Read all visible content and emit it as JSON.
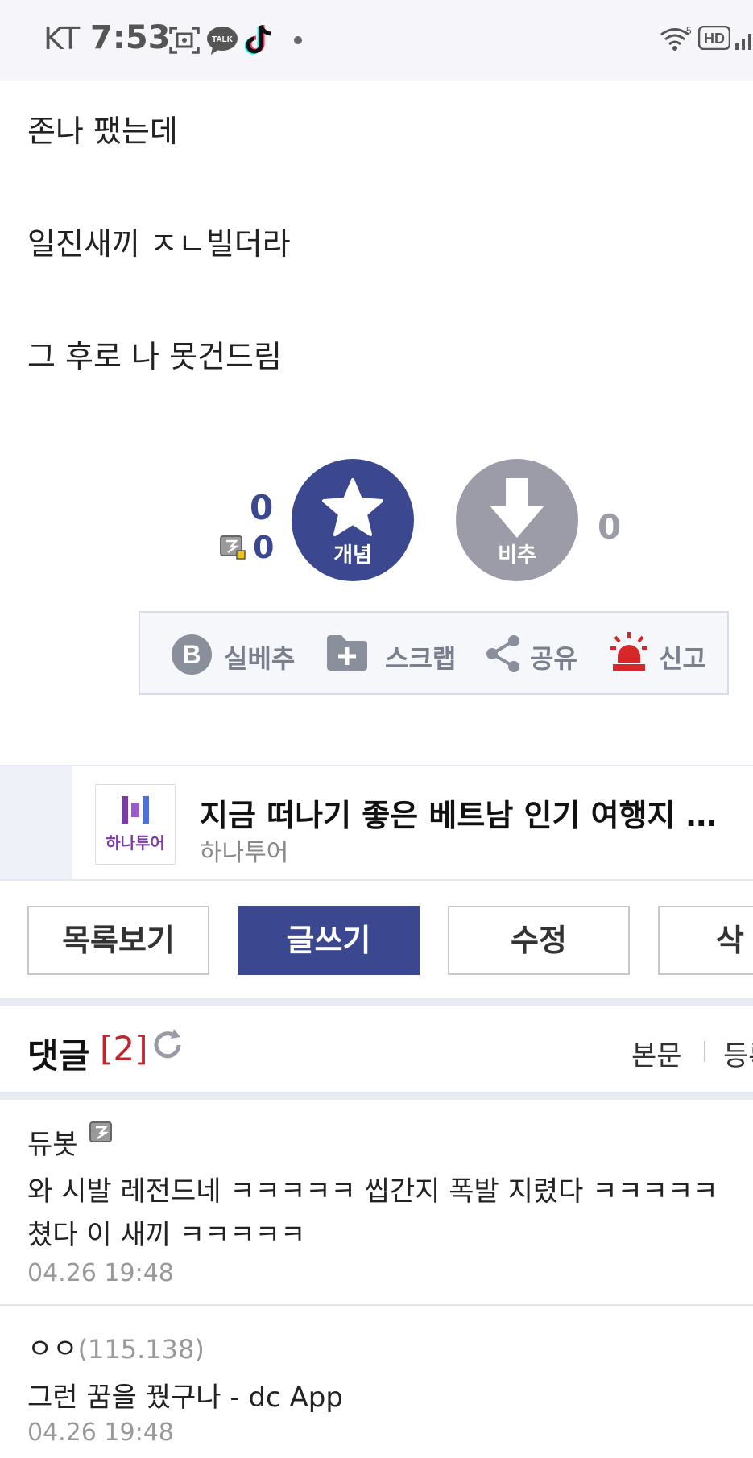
{
  "status_bar": {
    "carrier": "KT",
    "time": "7:53",
    "icons": [
      "screenshot-icon",
      "kakaotalk-icon",
      "tiktok-icon",
      "dot-icon",
      "wifi-icon",
      "hd-icon",
      "signal-icon"
    ],
    "talk_badge": "TALK",
    "hd_badge": "HD"
  },
  "post": {
    "lines": [
      "존나 팼는데",
      "일진새끼 ㅈㄴ빌더라",
      "그 후로 나 못건드림"
    ]
  },
  "recommend": {
    "up_count": "0",
    "fixed_count": "0",
    "up_label": "개념",
    "down_label": "비추",
    "down_count": "0",
    "up_color": "#3b4890",
    "down_color": "#9b9ca8"
  },
  "actions": {
    "best_label": "실베추",
    "scrap_label": "스크랩",
    "share_label": "공유",
    "report_label": "신고"
  },
  "ad": {
    "title": "지금 떠나기 좋은 베트남 인기 여행지 …",
    "sponsor": "하나투어",
    "logo_text": "하나투어"
  },
  "buttons": {
    "list": "목록보기",
    "write": "글쓰기",
    "edit": "수정",
    "delete": "삭제"
  },
  "comments_header": {
    "title": "댓글",
    "count": "[2]",
    "sort_body": "본문",
    "sort_reg": "등록순"
  },
  "comments": [
    {
      "nick": "듀봇",
      "text_line1": "와 시발 레전드네 ㅋㅋㅋㅋㅋ 씹간지 폭발 지렸다 ㅋㅋㅋㅋㅋ",
      "text_line2": "쳤다 이 새끼 ㅋㅋㅋㅋㅋ",
      "date": "04.26 19:48"
    },
    {
      "nick": "ㅇㅇ",
      "ip": "(115.138)",
      "text_line1": "그런 꿈을 꿨구나 - dc App",
      "date": "04.26 19:48"
    }
  ]
}
